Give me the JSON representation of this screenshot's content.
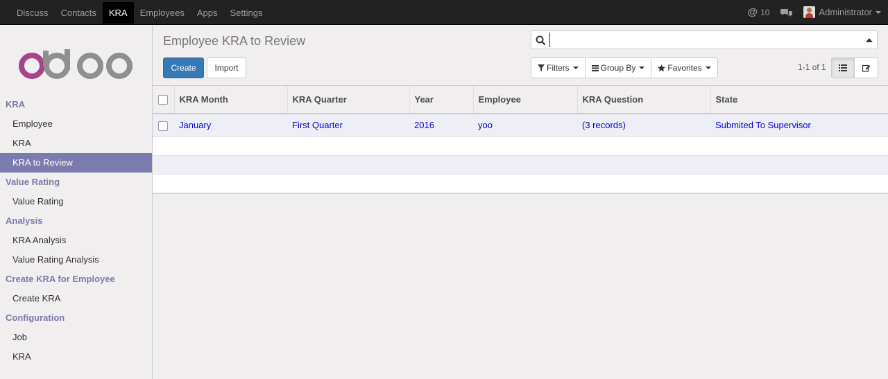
{
  "topnav": {
    "items": [
      {
        "label": "Discuss"
      },
      {
        "label": "Contacts"
      },
      {
        "label": "KRA"
      },
      {
        "label": "Employees"
      },
      {
        "label": "Apps"
      },
      {
        "label": "Settings"
      }
    ],
    "active_index": 2,
    "mention_count": "10",
    "user_name": "Administrator",
    "icons": {
      "mention": "at-icon",
      "chat": "chat-bubbles-icon",
      "avatar": "user-avatar"
    }
  },
  "sidebar": {
    "sections": [
      {
        "title": "KRA",
        "items": [
          "Employee",
          "KRA",
          "KRA to Review"
        ]
      },
      {
        "title": "Value Rating",
        "items": [
          "Value Rating"
        ]
      },
      {
        "title": "Analysis",
        "items": [
          "KRA Analysis",
          "Value Rating Analysis"
        ]
      },
      {
        "title": "Create KRA for Employee",
        "items": [
          "Create KRA"
        ]
      },
      {
        "title": "Configuration",
        "items": [
          "Job",
          "KRA"
        ]
      }
    ],
    "active_item": "KRA to Review"
  },
  "control_panel": {
    "breadcrumb": "Employee KRA to Review",
    "create_label": "Create",
    "import_label": "Import",
    "search": {
      "placeholder": "",
      "value": ""
    },
    "filters_label": "Filters",
    "groupby_label": "Group By",
    "favorites_label": "Favorites",
    "pager": "1-1 of 1"
  },
  "table": {
    "columns": [
      "KRA Month",
      "KRA Quarter",
      "Year",
      "Employee",
      "KRA Question",
      "State"
    ],
    "rows": [
      {
        "month": "January",
        "quarter": "First Quarter",
        "year": "2016",
        "employee": "yoo",
        "question": "(3 records)",
        "state": "Submited To Supervisor"
      }
    ]
  },
  "colors": {
    "topbar": "#222222",
    "accent": "#7c7bad",
    "primary_button": "#337ab7",
    "link": "#0000d8"
  }
}
